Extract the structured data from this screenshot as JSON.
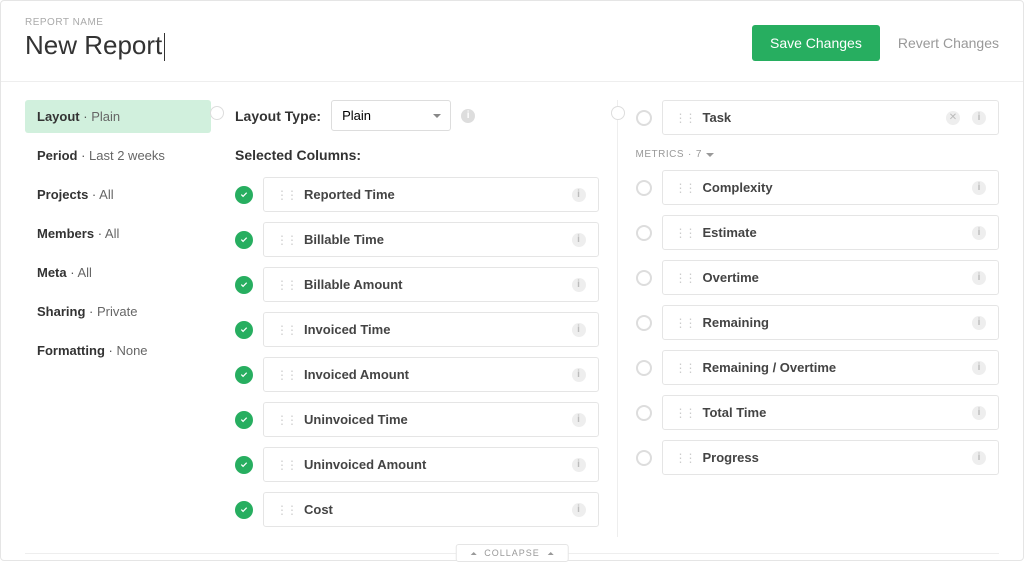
{
  "header": {
    "label": "REPORT NAME",
    "title": "New Report",
    "save_btn": "Save Changes",
    "revert_btn": "Revert Changes"
  },
  "sidebar": [
    {
      "key": "Layout",
      "value": "Plain",
      "active": true
    },
    {
      "key": "Period",
      "value": "Last 2 weeks",
      "active": false
    },
    {
      "key": "Projects",
      "value": "All",
      "active": false
    },
    {
      "key": "Members",
      "value": "All",
      "active": false
    },
    {
      "key": "Meta",
      "value": "All",
      "active": false
    },
    {
      "key": "Sharing",
      "value": "Private",
      "active": false
    },
    {
      "key": "Formatting",
      "value": "None",
      "active": false
    }
  ],
  "layout": {
    "type_label": "Layout Type:",
    "type_value": "Plain",
    "selected_columns_label": "Selected Columns:",
    "columns": [
      "Reported Time",
      "Billable Time",
      "Billable Amount",
      "Invoiced Time",
      "Invoiced Amount",
      "Uninvoiced Time",
      "Uninvoiced Amount",
      "Cost"
    ]
  },
  "right": {
    "group_item": "Task",
    "metrics_label": "METRICS",
    "metrics_count": "7",
    "metrics": [
      "Complexity",
      "Estimate",
      "Overtime",
      "Remaining",
      "Remaining / Overtime",
      "Total Time",
      "Progress"
    ]
  },
  "footer": {
    "collapse": "COLLAPSE"
  }
}
